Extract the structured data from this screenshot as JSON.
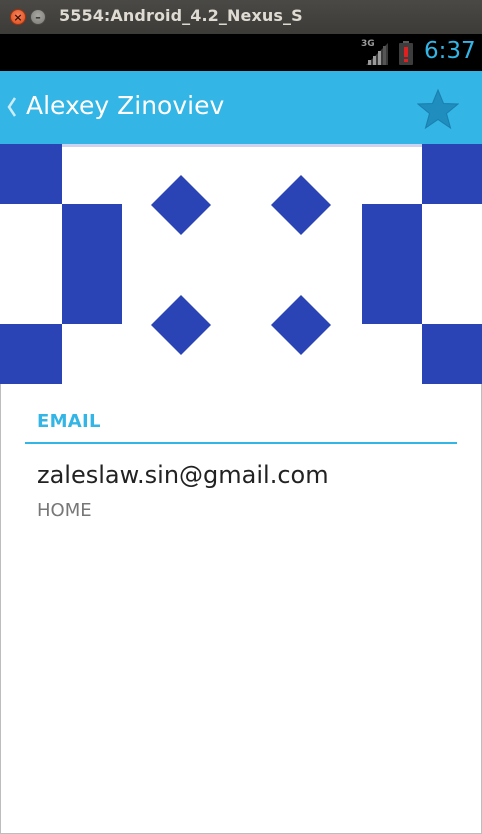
{
  "window": {
    "title": "5554:Android_4.2_Nexus_S",
    "close_glyph": "×",
    "minimize_glyph": "–"
  },
  "status_bar": {
    "network_type": "3G",
    "time": "6:37",
    "colors": {
      "clock": "#33b5e5",
      "background": "#000000"
    }
  },
  "action_bar": {
    "title": "Alexey Zinoviev",
    "up_icon": "chevron-left-icon",
    "star_icon": "star-icon",
    "colors": {
      "background": "#33b5e5",
      "star": "#1f8dbd"
    }
  },
  "contact_photo": {
    "description_icon": "geometric-pattern",
    "colors": {
      "pattern": "#2b44b5",
      "background": "#ffffff"
    }
  },
  "details": {
    "email_section": {
      "header": "EMAIL",
      "value": "zaleslaw.sin@gmail.com",
      "type": "HOME"
    },
    "colors": {
      "accent": "#33b5e5"
    }
  }
}
